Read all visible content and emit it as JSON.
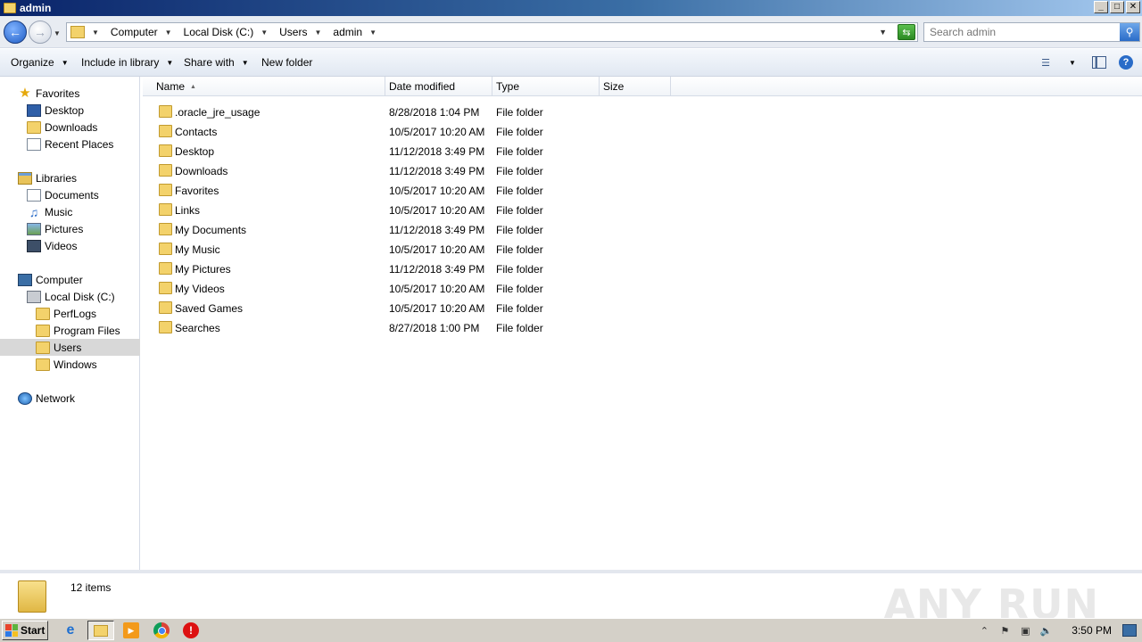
{
  "window": {
    "title": "admin"
  },
  "address": {
    "crumbs": [
      "Computer",
      "Local Disk (C:)",
      "Users",
      "admin"
    ]
  },
  "search": {
    "placeholder": "Search admin"
  },
  "toolbar": {
    "organize": "Organize",
    "include_in_library": "Include in library",
    "share_with": "Share with",
    "new_folder": "New folder"
  },
  "nav": {
    "favorites": {
      "label": "Favorites",
      "items": [
        "Desktop",
        "Downloads",
        "Recent Places"
      ]
    },
    "libraries": {
      "label": "Libraries",
      "items": [
        "Documents",
        "Music",
        "Pictures",
        "Videos"
      ]
    },
    "computer": {
      "label": "Computer",
      "disk": "Local Disk (C:)",
      "folders": [
        "PerfLogs",
        "Program Files",
        "Users",
        "Windows"
      ],
      "selected": "Users"
    },
    "network": {
      "label": "Network"
    }
  },
  "columns": {
    "name": "Name",
    "date": "Date modified",
    "type": "Type",
    "size": "Size"
  },
  "files": [
    {
      "name": ".oracle_jre_usage",
      "date": "8/28/2018 1:04 PM",
      "type": "File folder"
    },
    {
      "name": "Contacts",
      "date": "10/5/2017 10:20 AM",
      "type": "File folder"
    },
    {
      "name": "Desktop",
      "date": "11/12/2018 3:49 PM",
      "type": "File folder"
    },
    {
      "name": "Downloads",
      "date": "11/12/2018 3:49 PM",
      "type": "File folder"
    },
    {
      "name": "Favorites",
      "date": "10/5/2017 10:20 AM",
      "type": "File folder"
    },
    {
      "name": "Links",
      "date": "10/5/2017 10:20 AM",
      "type": "File folder"
    },
    {
      "name": "My Documents",
      "date": "11/12/2018 3:49 PM",
      "type": "File folder"
    },
    {
      "name": "My Music",
      "date": "10/5/2017 10:20 AM",
      "type": "File folder"
    },
    {
      "name": "My Pictures",
      "date": "11/12/2018 3:49 PM",
      "type": "File folder"
    },
    {
      "name": "My Videos",
      "date": "10/5/2017 10:20 AM",
      "type": "File folder"
    },
    {
      "name": "Saved Games",
      "date": "10/5/2017 10:20 AM",
      "type": "File folder"
    },
    {
      "name": "Searches",
      "date": "8/27/2018 1:00 PM",
      "type": "File folder"
    }
  ],
  "details": {
    "item_count": "12 items"
  },
  "watermark": "ANY RUN",
  "taskbar": {
    "start": "Start",
    "clock": "3:50 PM"
  }
}
